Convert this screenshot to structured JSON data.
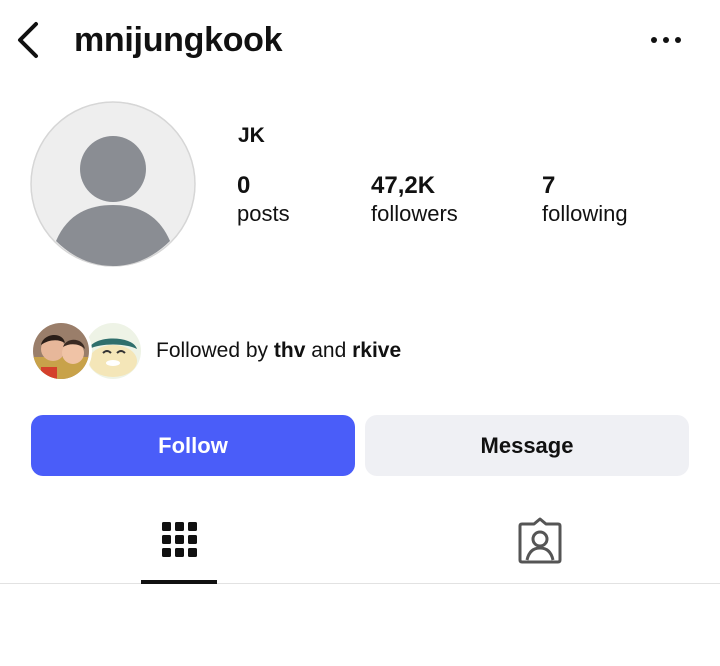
{
  "header": {
    "username": "mnijungkook",
    "back_icon": "chevron-left-icon",
    "more_icon": "ellipsis-horizontal-icon"
  },
  "profile": {
    "display_name": "JK",
    "avatar_icon": "default-avatar-icon",
    "stats": {
      "posts": {
        "value": "0",
        "label": "posts"
      },
      "followers": {
        "value": "47,2K",
        "label": "followers"
      },
      "following": {
        "value": "7",
        "label": "following"
      }
    }
  },
  "mutuals": {
    "prefix": "Followed by ",
    "user1": "thv",
    "joiner": " and ",
    "user2": "rkive"
  },
  "actions": {
    "follow_label": "Follow",
    "message_label": "Message"
  },
  "tabs": {
    "grid_icon": "grid-icon",
    "tagged_icon": "tagged-person-icon",
    "active": "grid"
  },
  "colors": {
    "accent": "#4a5df9",
    "secondary_button": "#eff0f4",
    "avatar_bg": "#eeeeee",
    "avatar_fg": "#8a8d93"
  }
}
